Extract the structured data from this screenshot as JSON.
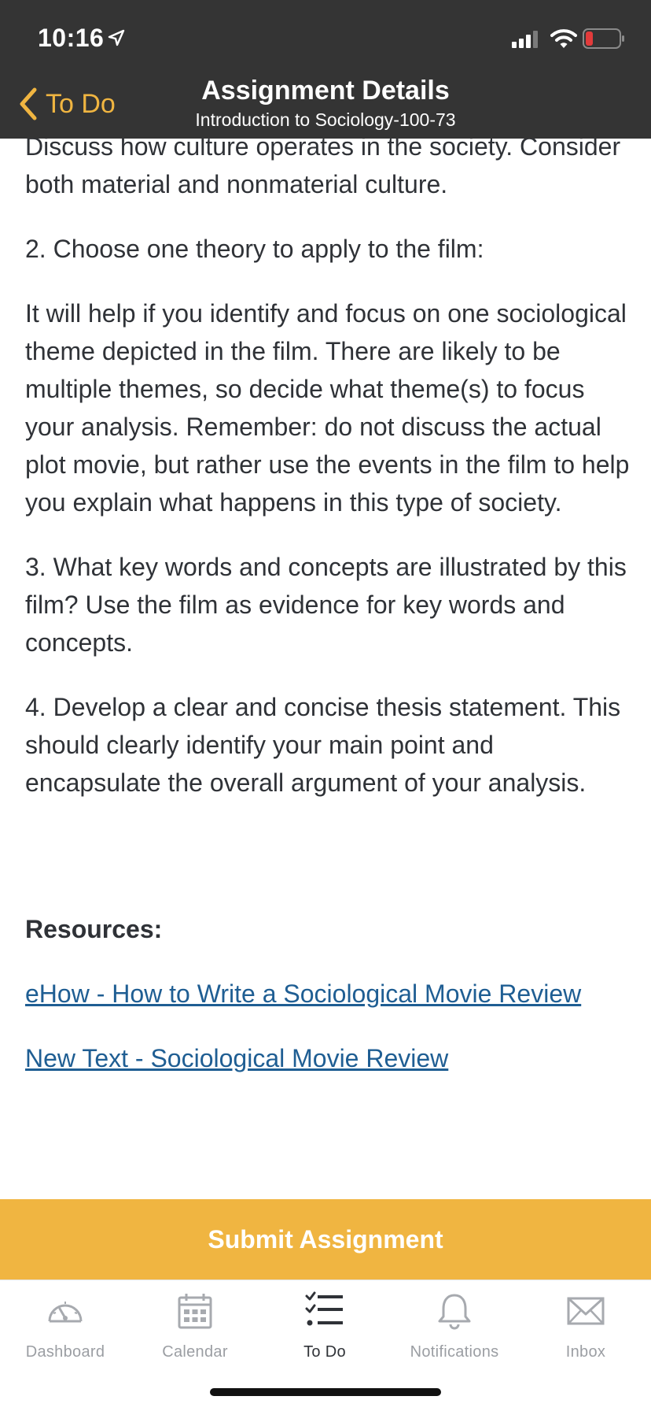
{
  "status_bar": {
    "time": "10:16"
  },
  "nav": {
    "back_label": "To Do",
    "title": "Assignment Details",
    "subtitle": "Introduction to Sociology-100-73"
  },
  "content": {
    "paragraphs": [
      "Discuss how culture operates in the society. Consider both material and nonmaterial culture.",
      "2. Choose one theory to apply to the film:",
      "It will help if you identify and focus on one sociological theme depicted in the film. There are likely to be multiple themes, so decide what theme(s) to focus your analysis. Remember: do not discuss the actual plot movie, but rather use the events in the film to help you explain what happens in this type of society.",
      "3. What key words and concepts are illustrated by this film? Use the film as evidence for key words and concepts.",
      "4. Develop a clear and concise thesis statement. This should clearly identify your main point and encapsulate the overall argument of your analysis."
    ],
    "resources_heading": "Resources:",
    "links": [
      "eHow - How to Write a Sociological Movie Review",
      "New Text - Sociological Movie Review"
    ]
  },
  "submit_label": "Submit Assignment",
  "tabs": [
    {
      "label": "Dashboard",
      "icon": "dashboard-gauge-icon",
      "active": false
    },
    {
      "label": "Calendar",
      "icon": "calendar-icon",
      "active": false
    },
    {
      "label": "To Do",
      "icon": "todo-checklist-icon",
      "active": true
    },
    {
      "label": "Notifications",
      "icon": "bell-icon",
      "active": false
    },
    {
      "label": "Inbox",
      "icon": "envelope-icon",
      "active": false
    }
  ],
  "colors": {
    "header_bg": "#343434",
    "accent": "#F0B541",
    "body_text": "#2f3237",
    "link": "#1f5e93",
    "inactive_tab": "#9b9ea3",
    "battery_low": "#e23b3b"
  }
}
